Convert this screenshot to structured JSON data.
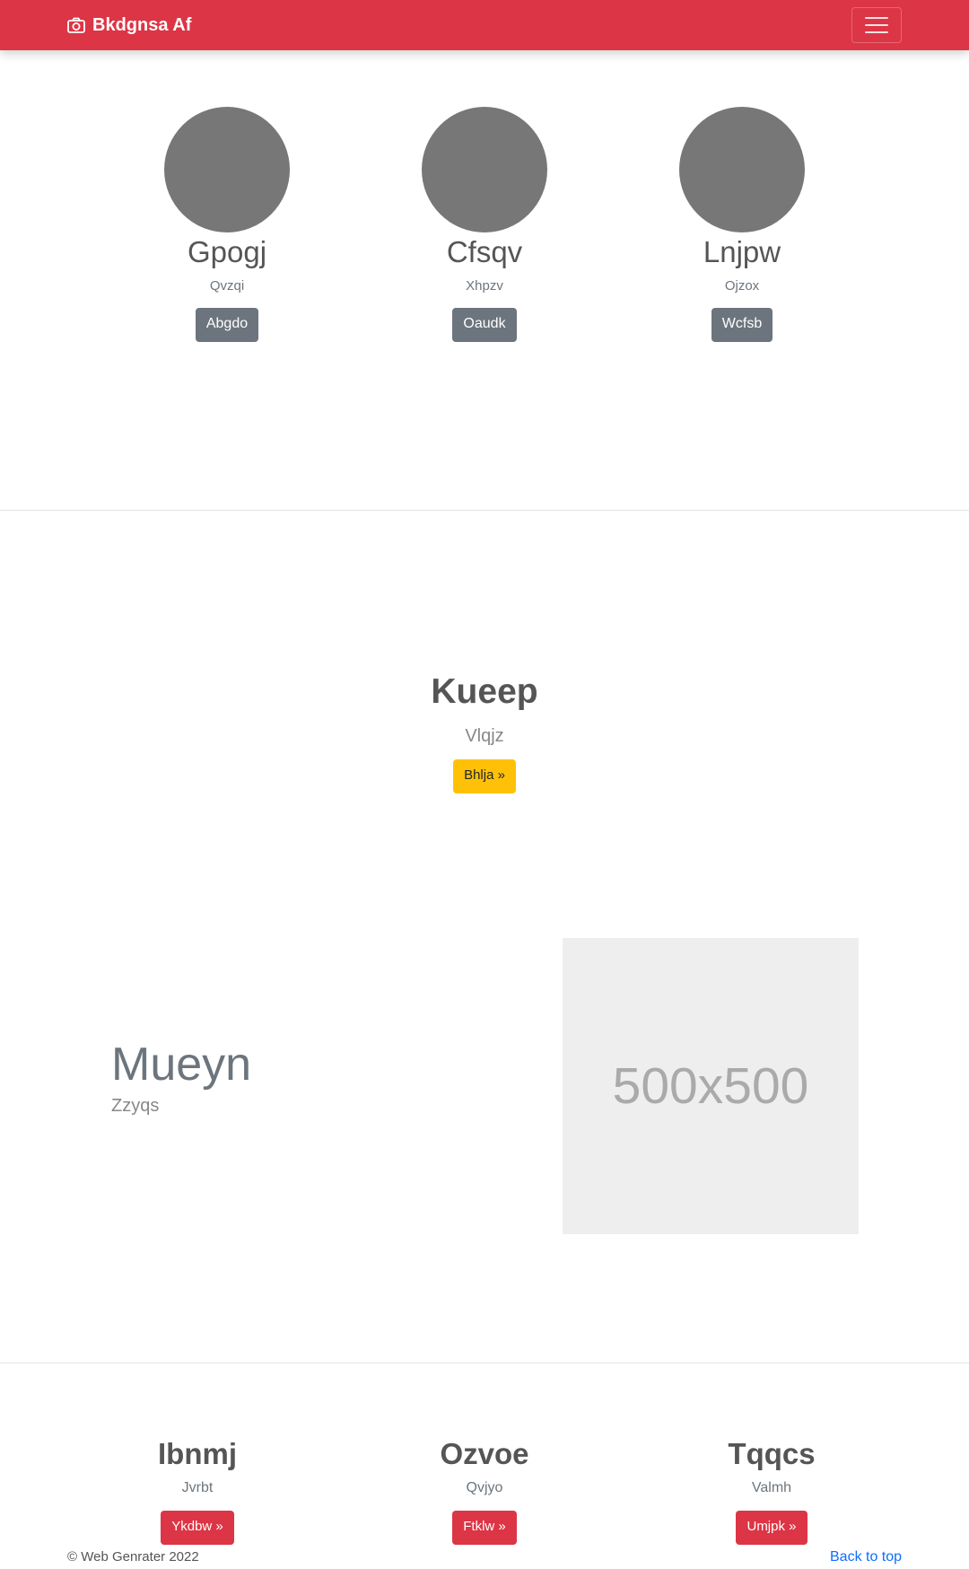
{
  "navbar": {
    "brand": "Bkdgnsa Af",
    "brand_icon": "camera-icon",
    "toggle_icon": "hamburger-menu-icon",
    "color": "#dc3545"
  },
  "team": [
    {
      "name": "Gpogj",
      "role": "Qvzqi",
      "button": "Abgdo"
    },
    {
      "name": "Cfsqv",
      "role": "Xhpzv",
      "button": "Oaudk"
    },
    {
      "name": "Lnjpw",
      "role": "Ojzox",
      "button": "Wcfsb"
    }
  ],
  "hero": {
    "title": "Kueep",
    "subtitle": "Vlqjz",
    "button": "Bhlja »",
    "button_color": "#ffc107"
  },
  "feature": {
    "title": "Mueyn",
    "subtitle": "Zzyqs",
    "image_label": "500x500"
  },
  "columns": [
    {
      "title": "Ibnmj",
      "subtitle": "Jvrbt",
      "button": "Ykdbw »"
    },
    {
      "title": "Ozvoe",
      "subtitle": "Qvjyo",
      "button": "Ftklw »"
    },
    {
      "title": "Tqqcs",
      "subtitle": "Valmh",
      "button": "Umjpk »"
    }
  ],
  "footer": {
    "copyright": "© Web Genrater 2022",
    "back_to_top": "Back to top"
  }
}
